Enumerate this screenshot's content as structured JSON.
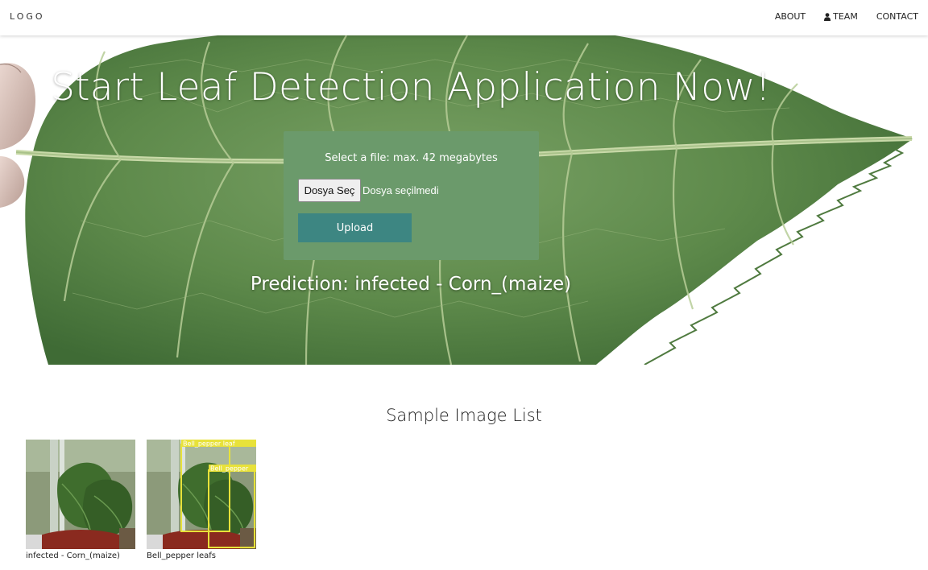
{
  "navbar": {
    "logo": "LOGO",
    "links": [
      {
        "label": "ABOUT",
        "icon": null
      },
      {
        "label": "TEAM",
        "icon": "user-icon"
      },
      {
        "label": "CONTACT",
        "icon": null
      }
    ]
  },
  "hero": {
    "title": "Start Leaf Detection Application Now!",
    "upload": {
      "caption": "Select a file: max. 42 megabytes",
      "file_button_label": "Dosya Seç",
      "file_status": "Dosya seçilmedi",
      "upload_button_label": "Upload"
    },
    "prediction": "Prediction: infected - Corn_(maize)"
  },
  "samples": {
    "title": "Sample Image List",
    "items": [
      {
        "caption": "infected - Corn_(maize)",
        "overlay_labels": []
      },
      {
        "caption": "Bell_pepper leafs",
        "overlay_labels": [
          "Bell_pepper leaf",
          "Bell_pepper"
        ]
      }
    ]
  },
  "colors": {
    "upload_panel": "#6b9a6b",
    "upload_button": "#3d8682",
    "leaf_green": "#5d8a4a",
    "detection_box": "#e8e23a"
  }
}
